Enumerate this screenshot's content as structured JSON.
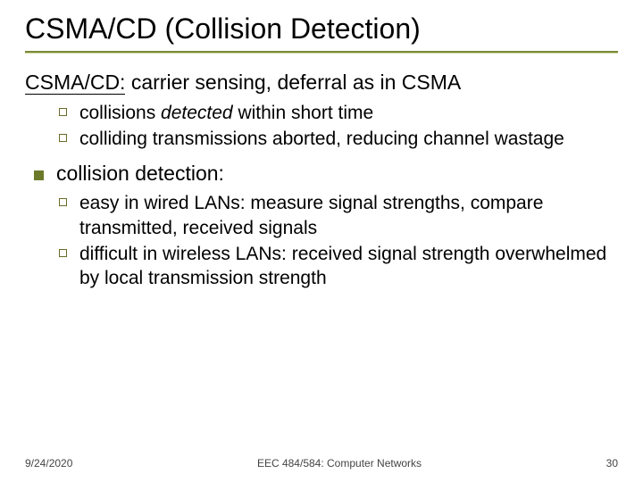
{
  "title": "CSMA/CD (Collision Detection)",
  "lead_prefix": "CSMA/CD:",
  "lead_rest": " carrier sensing, deferral as in CSMA",
  "sub_a": {
    "b1_pre": "collisions ",
    "b1_em": "detected",
    "b1_post": " within short time",
    "b2": "colliding transmissions aborted, reducing channel wastage"
  },
  "detection_label": "collision detection:",
  "sub_b": {
    "b1": "easy in wired LANs: measure signal strengths, compare transmitted, received signals",
    "b2": "difficult in wireless LANs: received signal strength overwhelmed by local transmission strength"
  },
  "footer": {
    "date": "9/24/2020",
    "course": "EEC 484/584: Computer Networks",
    "page": "30"
  }
}
